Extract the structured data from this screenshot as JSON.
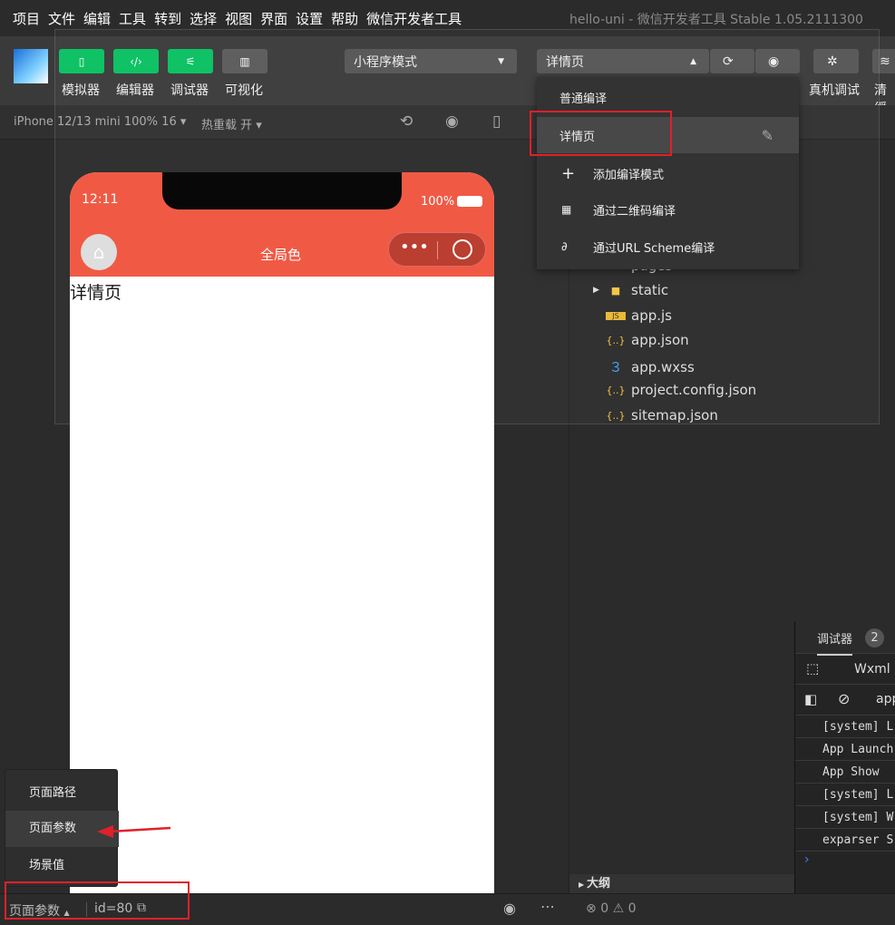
{
  "menubar": {
    "items": [
      "项目",
      "文件",
      "编辑",
      "工具",
      "转到",
      "选择",
      "视图",
      "界面",
      "设置",
      "帮助",
      "微信开发者工具"
    ],
    "title": "hello-uni - 微信开发者工具 Stable 1.05.2111300"
  },
  "toolbar": {
    "simulator": "模拟器",
    "editor": "编辑器",
    "debugger": "调试器",
    "visual": "可视化",
    "mode": "小程序模式",
    "compile": "详情页",
    "real_debug": "真机调试",
    "clear": "清缓"
  },
  "subbar": {
    "device": "iPhone 12/13 mini 100% 16",
    "hot_reload": "热重载 开"
  },
  "phone": {
    "time": "12:11",
    "battery": "100%",
    "nav_title": "全局色",
    "page_text": "详情页"
  },
  "dropdown": {
    "items": [
      "普通编译",
      "详情页",
      "添加编译模式",
      "通过二维码编译",
      "通过URL Scheme编译"
    ]
  },
  "tree": {
    "items": [
      {
        "name": "pages",
        "icon": "folder"
      },
      {
        "name": "static",
        "icon": "folder"
      },
      {
        "name": "app.js",
        "icon": "JS"
      },
      {
        "name": "app.json",
        "icon": "{..}"
      },
      {
        "name": "app.wxss",
        "icon": "css"
      },
      {
        "name": "project.config.json",
        "icon": "{..}"
      },
      {
        "name": "sitemap.json",
        "icon": "{..}"
      }
    ],
    "outline": "大纲"
  },
  "debugger": {
    "tab": "调试器",
    "badge": "2",
    "wxml": "Wxml",
    "filter": "app",
    "logs": [
      "[system] L",
      "App Launch",
      "App Show",
      "[system] L",
      "[system] W",
      "exparser S"
    ]
  },
  "popup": {
    "items": [
      "页面路径",
      "页面参数",
      "场景值"
    ]
  },
  "status": {
    "param_label": "页面参数",
    "param_value": "id=80",
    "errors": "0",
    "warnings": "0"
  },
  "colors": {
    "accent": "#07c160",
    "nav": "#f0553f",
    "highlight": "#e0202a"
  }
}
